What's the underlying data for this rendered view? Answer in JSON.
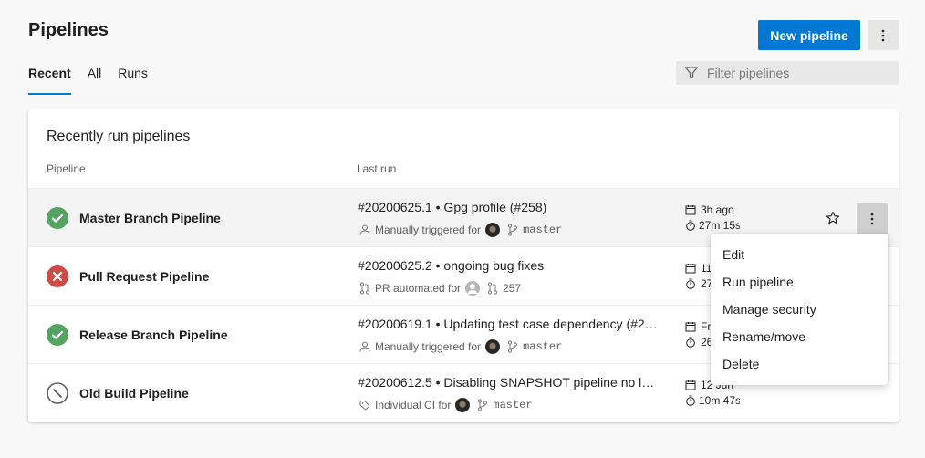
{
  "page": {
    "title": "Pipelines"
  },
  "header": {
    "new_pipeline_label": "New pipeline",
    "more_icon": "more-vertical-icon"
  },
  "tabs": [
    {
      "label": "Recent",
      "active": true
    },
    {
      "label": "All",
      "active": false
    },
    {
      "label": "Runs",
      "active": false
    }
  ],
  "filter": {
    "placeholder": "Filter pipelines",
    "icon": "filter-icon"
  },
  "card": {
    "title": "Recently run pipelines",
    "columns": {
      "pipeline": "Pipeline",
      "last_run": "Last run"
    }
  },
  "rows": [
    {
      "status": "succeeded",
      "name": "Master Branch Pipeline",
      "run_title": "#20200625.1 • Gpg profile (#258)",
      "trigger": "Manually triggered for",
      "trigger_icon": "person-icon",
      "ref_icon": "branch-icon",
      "ref": "master",
      "when": "3h ago",
      "duration": "27m 15s"
    },
    {
      "status": "failed",
      "name": "Pull Request Pipeline",
      "run_title": "#20200625.2 • ongoing bug fixes",
      "trigger": "PR automated for",
      "trigger_icon": "pull-request-icon",
      "ref_icon": "pull-request-icon",
      "ref": "257",
      "when": "11",
      "duration": "27"
    },
    {
      "status": "succeeded",
      "name": "Release Branch Pipeline",
      "run_title": "#20200619.1 • Updating test case dependency (#2…",
      "trigger": "Manually triggered for",
      "trigger_icon": "person-icon",
      "ref_icon": "branch-icon",
      "ref": "master",
      "when": "Fr",
      "duration": "26"
    },
    {
      "status": "disabled",
      "name": "Old Build Pipeline",
      "run_title": "#20200612.5 • Disabling SNAPSHOT pipeline no l…",
      "trigger": "Individual CI for",
      "trigger_icon": "tag-icon",
      "ref_icon": "branch-icon",
      "ref": "master",
      "when": "12 Jun",
      "duration": "10m 47s"
    }
  ],
  "context_menu": {
    "items": [
      "Edit",
      "Run pipeline",
      "Manage security",
      "Rename/move",
      "Delete"
    ]
  },
  "colors": {
    "accent": "#0078d4",
    "success": "#55a362",
    "failed": "#cd4a45",
    "disabled": "#605e5c"
  }
}
